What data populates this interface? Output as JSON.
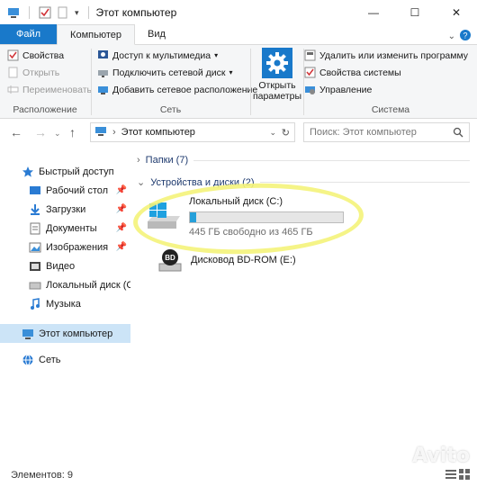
{
  "window": {
    "title": "Этот компьютер",
    "controls": [
      "minimize",
      "maximize",
      "close"
    ]
  },
  "ribbon_tabs": {
    "file": "Файл",
    "computer": "Компьютер",
    "view": "Вид"
  },
  "ribbon": {
    "location": {
      "label": "Расположение",
      "properties": "Свойства",
      "open": "Открыть",
      "rename": "Переименовать"
    },
    "network": {
      "label": "Сеть",
      "media_access": "Доступ к мультимедиа",
      "map_drive": "Подключить сетевой диск",
      "add_location": "Добавить сетевое расположение"
    },
    "open_settings": {
      "line1": "Открыть",
      "line2": "параметры"
    },
    "system": {
      "label": "Система",
      "uninstall": "Удалить или изменить программу",
      "system_properties": "Свойства системы",
      "manage": "Управление"
    }
  },
  "address": {
    "path_root": "›",
    "path": "Этот компьютер",
    "search_placeholder": "Поиск: Этот компьютер"
  },
  "nav_pane": {
    "quick_access": "Быстрый доступ",
    "items": [
      {
        "label": "Рабочий стол",
        "pinned": true
      },
      {
        "label": "Загрузки",
        "pinned": true
      },
      {
        "label": "Документы",
        "pinned": true
      },
      {
        "label": "Изображения",
        "pinned": true
      },
      {
        "label": "Видео",
        "pinned": false
      },
      {
        "label": "Локальный диск (C",
        "pinned": false
      },
      {
        "label": "Музыка",
        "pinned": false
      }
    ],
    "this_pc": "Этот компьютер",
    "network": "Сеть"
  },
  "content": {
    "folders_header": "Папки (7)",
    "devices_header": "Устройства и диски (2)",
    "drives": [
      {
        "name": "Локальный диск (C:)",
        "free_text": "445 ГБ свободно из 465 ГБ",
        "used_fraction": 0.043
      },
      {
        "name": "Дисковод BD-ROM (E:)"
      }
    ]
  },
  "status": {
    "items_count": "Элементов: 9"
  },
  "colors": {
    "file_tab": "#1979ca",
    "progress": "#26a0da",
    "selection": "#cce4f7",
    "highlight": "#f4f37a"
  },
  "watermark": "Avito"
}
